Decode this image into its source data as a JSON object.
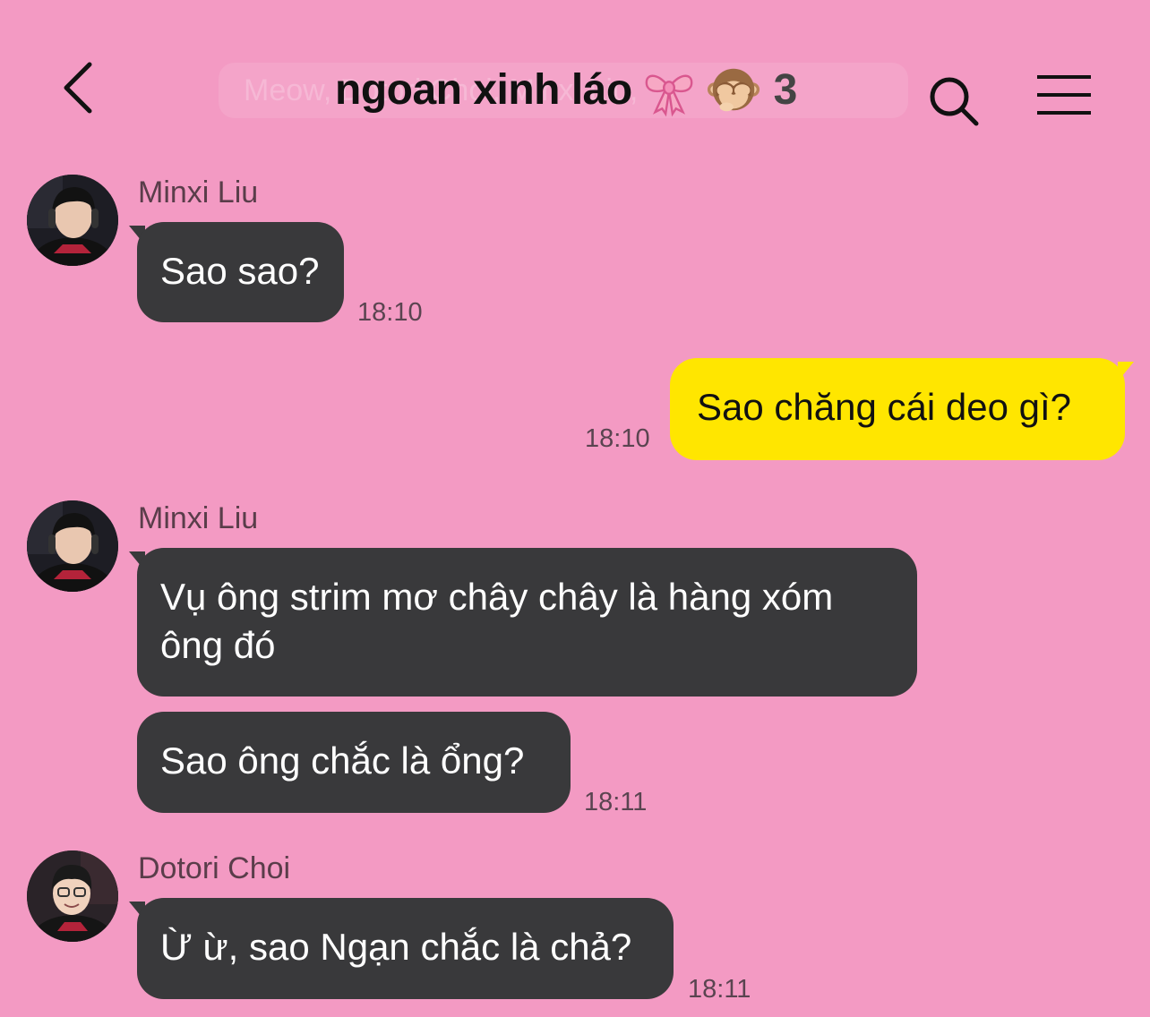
{
  "header": {
    "back_icon": "chevron-left-icon",
    "ghost_text": "Meow, Dotori Choi, Minxi Liu,",
    "title": "ngoan xinh láo",
    "title_emojis": [
      "ribbon-emoji",
      "see-no-evil-monkey-emoji"
    ],
    "member_count": "3",
    "search_icon": "search-icon",
    "menu_icon": "hamburger-menu-icon"
  },
  "messages": [
    {
      "sender": "Minxi Liu",
      "text": "Sao sao?",
      "time": "18:10"
    },
    {
      "text": "Sao chăng cái deo gì?",
      "time": "18:10",
      "mine": true
    },
    {
      "sender": "Minxi Liu",
      "text": "Vụ ông strim mơ chây chây là hàng xóm ông đó"
    },
    {
      "text": "Sao ông chắc là ổng?",
      "time": "18:11"
    },
    {
      "sender": "Dotori Choi",
      "text": "Ừ ừ, sao Ngạn chắc là chả?",
      "time": "18:11"
    }
  ],
  "colors": {
    "background": "#f39ac3",
    "incoming_bubble": "#39393b",
    "outgoing_bubble": "#ffe600"
  }
}
